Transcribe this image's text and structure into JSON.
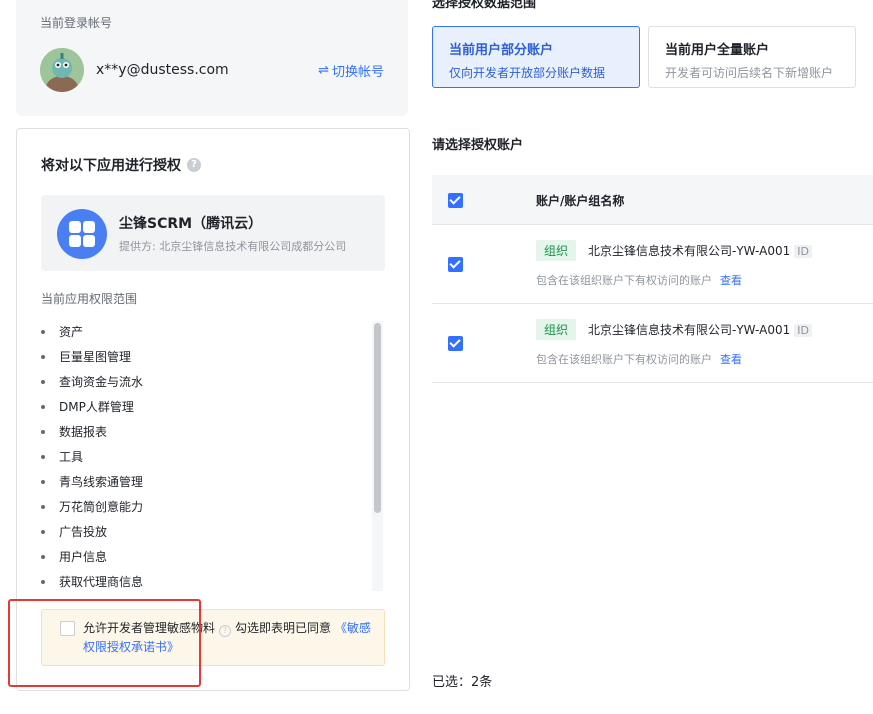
{
  "account": {
    "label": "当前登录帐号",
    "email": "x**y@dustess.com",
    "switch_label": "切换帐号",
    "switch_icon": "swap-icon"
  },
  "auth": {
    "title": "将对以下应用进行授权",
    "app": {
      "name": "尘锋SCRM（腾讯云）",
      "provider": "提供方: 北京尘锋信息技术有限公司成都分公司"
    },
    "scope_label": "当前应用权限范围",
    "scopes": [
      "资产",
      "巨量星图管理",
      "查询资金与流水",
      "DMP人群管理",
      "数据报表",
      "工具",
      "青鸟线索通管理",
      "万花筒创意能力",
      "广告投放",
      "用户信息",
      "获取代理商信息"
    ],
    "sensitive": {
      "text": "允许开发者管理敏感物料",
      "agree_prefix": "勾选即表明已同意",
      "link": "《敏感权限授权承诺书》"
    }
  },
  "range": {
    "heading": "选择授权数据范围",
    "options": [
      {
        "title": "当前用户部分账户",
        "desc": "仅向开发者开放部分账户数据"
      },
      {
        "title": "当前用户全量账户",
        "desc": "开发者可访问后续名下新增账户"
      }
    ]
  },
  "accounts": {
    "heading": "请选择授权账户",
    "column": "账户/账户组名称",
    "rows": [
      {
        "tag": "组织",
        "name": "北京尘锋信息技术有限公司-YW-A001",
        "id_tag": "ID",
        "desc": "包含在该组织账户下有权访问的账户",
        "view": "查看"
      },
      {
        "tag": "组织",
        "name": "北京尘锋信息技术有限公司-YW-A001",
        "id_tag": "ID",
        "desc": "包含在该组织账户下有权访问的账户",
        "view": "查看"
      }
    ],
    "selected": "已选：2条"
  },
  "colors": {
    "accent": "#3370ff",
    "org_green": "#1a8f4a",
    "highlight_red": "#e53935"
  }
}
